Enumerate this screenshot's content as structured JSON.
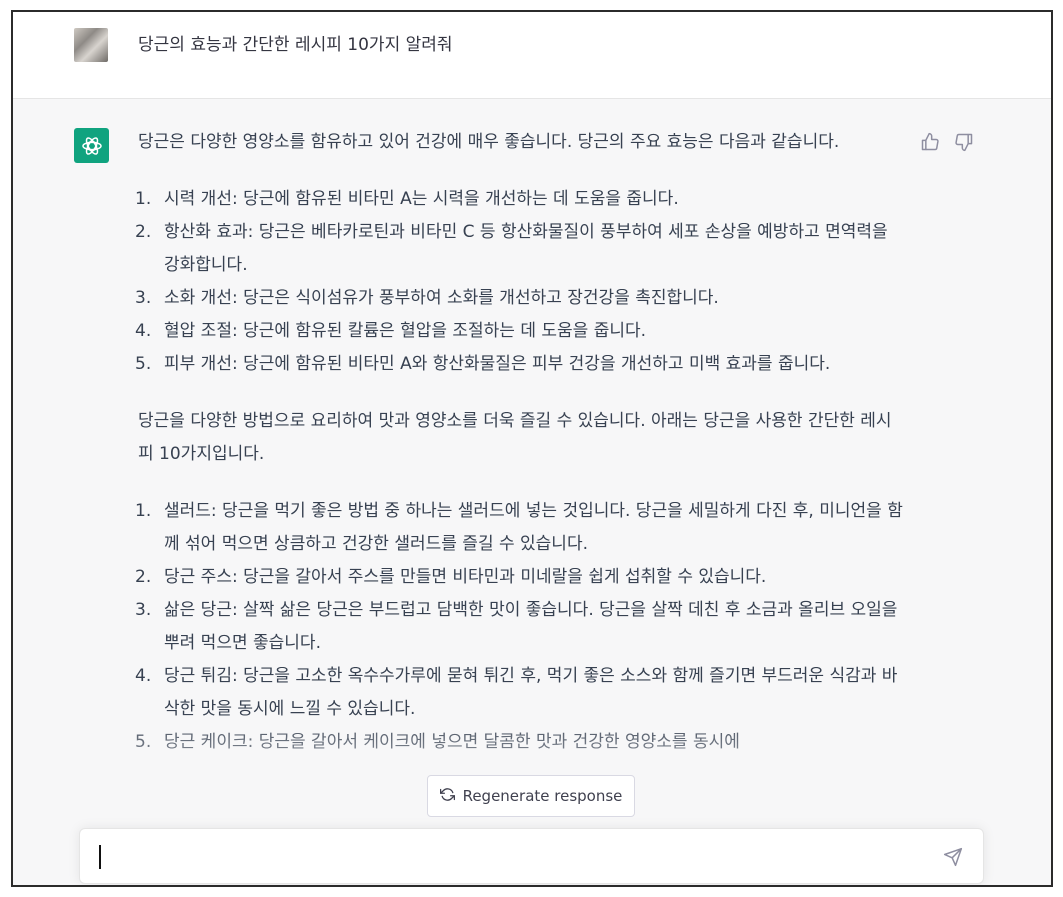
{
  "user": {
    "message": "당근의 효능과 간단한 레시피 10가지 알려줘"
  },
  "assistant": {
    "intro": "당근은 다양한 영양소를 함유하고 있어 건강에 매우 좋습니다. 당근의 주요 효능은 다음과 같습니다.",
    "benefits": [
      {
        "num": "1.",
        "text": "시력 개선: 당근에 함유된 비타민 A는 시력을 개선하는 데 도움을 줍니다."
      },
      {
        "num": "2.",
        "text": "항산화 효과: 당근은 베타카로틴과 비타민 C 등 항산화물질이 풍부하여 세포 손상을 예방하고 면역력을 강화합니다."
      },
      {
        "num": "3.",
        "text": "소화 개선: 당근은 식이섬유가 풍부하여 소화를 개선하고 장건강을 촉진합니다."
      },
      {
        "num": "4.",
        "text": "혈압 조절: 당근에 함유된 칼륨은 혈압을 조절하는 데 도움을 줍니다."
      },
      {
        "num": "5.",
        "text": "피부 개선: 당근에 함유된 비타민 A와 항산화물질은 피부 건강을 개선하고 미백 효과를 줍니다."
      }
    ],
    "recipes_intro": "당근을 다양한 방법으로 요리하여 맛과 영양소를 더욱 즐길 수 있습니다. 아래는 당근을 사용한 간단한 레시피 10가지입니다.",
    "recipes": [
      {
        "num": "1.",
        "text": "샐러드: 당근을 먹기 좋은 방법 중 하나는 샐러드에 넣는 것입니다. 당근을 세밀하게 다진 후, 미니언을 함께 섞어 먹으면 상큼하고 건강한 샐러드를 즐길 수 있습니다."
      },
      {
        "num": "2.",
        "text": "당근 주스: 당근을 갈아서 주스를 만들면 비타민과 미네랄을 쉽게 섭취할 수 있습니다."
      },
      {
        "num": "3.",
        "text": "삶은 당근: 살짝 삶은 당근은 부드럽고 담백한 맛이 좋습니다. 당근을 살짝 데친 후 소금과 올리브 오일을 뿌려 먹으면 좋습니다."
      },
      {
        "num": "4.",
        "text": "당근 튀김: 당근을 고소한 옥수수가루에 묻혀 튀긴 후, 먹기 좋은 소스와 함께 즐기면 부드러운 식감과 바삭한 맛을 동시에 느낄 수 있습니다."
      },
      {
        "num": "5.",
        "text": "당근 케이크: 당근을 갈아서 케이크에 넣으면 달콤한 맛과 건강한 영양소를 동시에"
      }
    ]
  },
  "regenerate": {
    "label": "Regenerate response"
  },
  "composer": {
    "placeholder": ""
  },
  "colors": {
    "brand": "#10a37f",
    "panel_bg": "#f7f7f8"
  },
  "icons": {
    "bot": "openai-logo-icon",
    "like": "thumbs-up-icon",
    "dislike": "thumbs-down-icon",
    "regenerate": "refresh-icon",
    "send": "paper-plane-icon"
  }
}
